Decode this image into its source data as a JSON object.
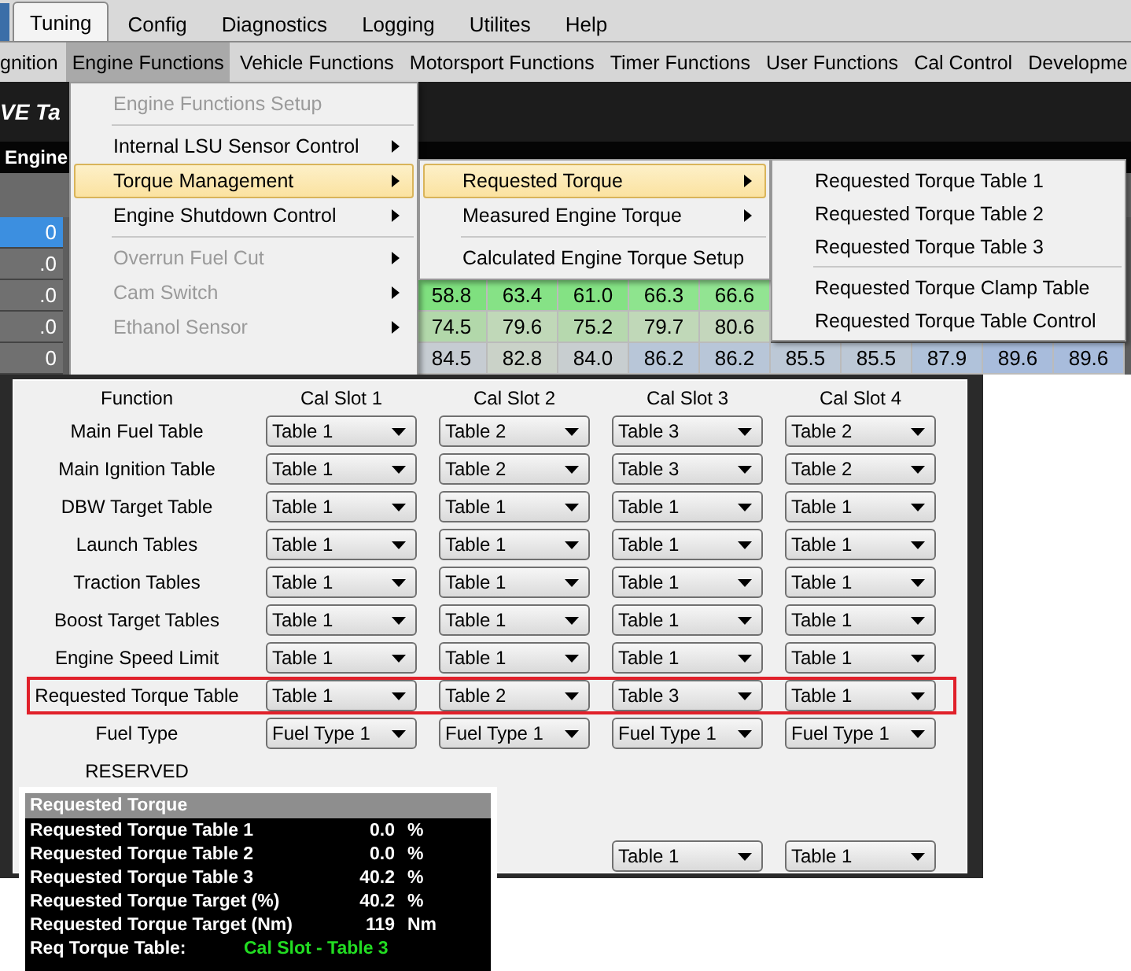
{
  "tabs": [
    {
      "label": "Tuning",
      "selected": true
    },
    {
      "label": "Config",
      "selected": false
    },
    {
      "label": "Diagnostics",
      "selected": false
    },
    {
      "label": "Logging",
      "selected": false
    },
    {
      "label": "Utilites",
      "selected": false
    },
    {
      "label": "Help",
      "selected": false
    }
  ],
  "menu_bar": [
    {
      "label": "gnition",
      "open": false
    },
    {
      "label": "Engine Functions",
      "open": true
    },
    {
      "label": "Vehicle Functions",
      "open": false
    },
    {
      "label": "Motorsport Functions",
      "open": false
    },
    {
      "label": "Timer Functions",
      "open": false
    },
    {
      "label": "User Functions",
      "open": false
    },
    {
      "label": "Cal Control",
      "open": false
    },
    {
      "label": "Developme",
      "open": false
    }
  ],
  "view_title": "VE Ta",
  "grid": {
    "header": "Engine",
    "rows": [
      {
        "axis": "0",
        "selected": true,
        "cells": []
      },
      {
        "axis": ".0",
        "selected": false,
        "cells": []
      },
      {
        "axis": ".0",
        "selected": false,
        "cells": [
          {
            "text": "58.8",
            "color": "#7fe07f"
          },
          {
            "text": "63.4",
            "color": "#86e286"
          },
          {
            "text": "61.0",
            "color": "#84e284"
          },
          {
            "text": "66.3",
            "color": "#8ee48e"
          },
          {
            "text": "66.6",
            "color": "#92e492"
          }
        ]
      },
      {
        "axis": ".0",
        "selected": false,
        "cells": [
          {
            "text": "74.5",
            "color": "#b2d8aa"
          },
          {
            "text": "79.6",
            "color": "#c0d8b8"
          },
          {
            "text": "75.2",
            "color": "#b6d8ae"
          },
          {
            "text": "79.7",
            "color": "#c0d8b8"
          },
          {
            "text": "80.6",
            "color": "#c4d6bc"
          }
        ]
      },
      {
        "axis": "0",
        "selected": false,
        "cells": [
          {
            "text": "84.5",
            "color": "#c6ccd2"
          },
          {
            "text": "82.8",
            "color": "#cad2c8"
          },
          {
            "text": "84.0",
            "color": "#c8ced0"
          },
          {
            "text": "86.2",
            "color": "#b8c6d8"
          },
          {
            "text": "86.2",
            "color": "#b8c6d8"
          },
          {
            "text": "85.5",
            "color": "#bcc8d6"
          },
          {
            "text": "85.5",
            "color": "#bcc8d6"
          },
          {
            "text": "87.9",
            "color": "#b0c2da"
          },
          {
            "text": "89.6",
            "color": "#a8bcdc"
          },
          {
            "text": "89.6",
            "color": "#a8bcdc"
          }
        ]
      }
    ]
  },
  "engine_functions_menu": [
    {
      "kind": "item",
      "label": "Engine Functions Setup",
      "disabled": true,
      "submenu": false,
      "selected": false
    },
    {
      "kind": "separator"
    },
    {
      "kind": "item",
      "label": "Internal LSU Sensor Control",
      "disabled": false,
      "submenu": true,
      "selected": false
    },
    {
      "kind": "item",
      "label": "Torque Management",
      "disabled": false,
      "submenu": true,
      "selected": true
    },
    {
      "kind": "item",
      "label": "Engine Shutdown Control",
      "disabled": false,
      "submenu": true,
      "selected": false
    },
    {
      "kind": "separator"
    },
    {
      "kind": "item",
      "label": "Overrun Fuel Cut",
      "disabled": true,
      "submenu": true,
      "selected": false
    },
    {
      "kind": "item",
      "label": "Cam Switch",
      "disabled": true,
      "submenu": true,
      "selected": false
    },
    {
      "kind": "item",
      "label": "Ethanol Sensor",
      "disabled": true,
      "submenu": true,
      "selected": false
    }
  ],
  "torque_management_menu": [
    {
      "kind": "item",
      "label": "Requested  Torque",
      "disabled": false,
      "submenu": true,
      "selected": true
    },
    {
      "kind": "item",
      "label": "Measured Engine Torque",
      "disabled": false,
      "submenu": true,
      "selected": false
    },
    {
      "kind": "separator"
    },
    {
      "kind": "item",
      "label": "Calculated Engine Torque Setup",
      "disabled": false,
      "submenu": false,
      "selected": false
    }
  ],
  "requested_torque_menu": [
    {
      "kind": "item",
      "label": "Requested  Torque Table 1",
      "disabled": false,
      "submenu": false,
      "selected": false
    },
    {
      "kind": "item",
      "label": "Requested  Torque Table 2",
      "disabled": false,
      "submenu": false,
      "selected": false
    },
    {
      "kind": "item",
      "label": "Requested  Torque Table 3",
      "disabled": false,
      "submenu": false,
      "selected": false
    },
    {
      "kind": "separator"
    },
    {
      "kind": "item",
      "label": "Requested Torque Clamp Table",
      "disabled": false,
      "submenu": false,
      "selected": false
    },
    {
      "kind": "item",
      "label": "Requested Torque Table Control",
      "disabled": false,
      "submenu": false,
      "selected": false
    }
  ],
  "cal_slots": {
    "columns": [
      "Function",
      "Cal Slot 1",
      "Cal Slot 2",
      "Cal Slot 3",
      "Cal Slot 4"
    ],
    "rows": [
      {
        "label": "Main Fuel Table",
        "highlighted": false,
        "slots": [
          "Table 1",
          "Table 2",
          "Table 3",
          "Table 2"
        ]
      },
      {
        "label": "Main Ignition Table",
        "highlighted": false,
        "slots": [
          "Table 1",
          "Table 2",
          "Table 3",
          "Table 2"
        ]
      },
      {
        "label": "DBW Target Table",
        "highlighted": false,
        "slots": [
          "Table 1",
          "Table 1",
          "Table 1",
          "Table 1"
        ]
      },
      {
        "label": "Launch Tables",
        "highlighted": false,
        "slots": [
          "Table 1",
          "Table 1",
          "Table 1",
          "Table 1"
        ]
      },
      {
        "label": "Traction Tables",
        "highlighted": false,
        "slots": [
          "Table 1",
          "Table 1",
          "Table 1",
          "Table 1"
        ]
      },
      {
        "label": "Boost Target Tables",
        "highlighted": false,
        "slots": [
          "Table 1",
          "Table 1",
          "Table 1",
          "Table 1"
        ]
      },
      {
        "label": "Engine Speed Limit",
        "highlighted": false,
        "slots": [
          "Table 1",
          "Table 1",
          "Table 1",
          "Table 1"
        ]
      },
      {
        "label": "Requested Torque Table",
        "highlighted": true,
        "slots": [
          "Table 1",
          "Table 2",
          "Table 3",
          "Table 1"
        ]
      },
      {
        "label": "Fuel Type",
        "highlighted": false,
        "slots": [
          "Fuel Type 1",
          "Fuel Type 1",
          "Fuel Type 1",
          "Fuel Type 1"
        ]
      },
      {
        "label": "RESERVED",
        "highlighted": false,
        "slots": []
      }
    ],
    "lower_row_slots": [
      "Table 1",
      "Table 1"
    ]
  },
  "torque_panel": {
    "title": "Requested Torque",
    "rows": [
      {
        "kind": "reading",
        "label": "Requested Torque Table 1",
        "value": "0.0",
        "unit": "%"
      },
      {
        "kind": "reading",
        "label": "Requested Torque Table 2",
        "value": "0.0",
        "unit": "%"
      },
      {
        "kind": "reading",
        "label": "Requested Torque Table 3",
        "value": "40.2",
        "unit": "%"
      },
      {
        "kind": "reading",
        "label": "Requested Torque Target (%)",
        "value": "40.2",
        "unit": "%"
      },
      {
        "kind": "reading",
        "label": "Requested Torque Target (Nm)",
        "value": "119",
        "unit": "Nm"
      },
      {
        "kind": "status",
        "label": "Req Torque Table:",
        "value": "Cal Slot - Table 3",
        "color": "#22dd22"
      }
    ]
  }
}
